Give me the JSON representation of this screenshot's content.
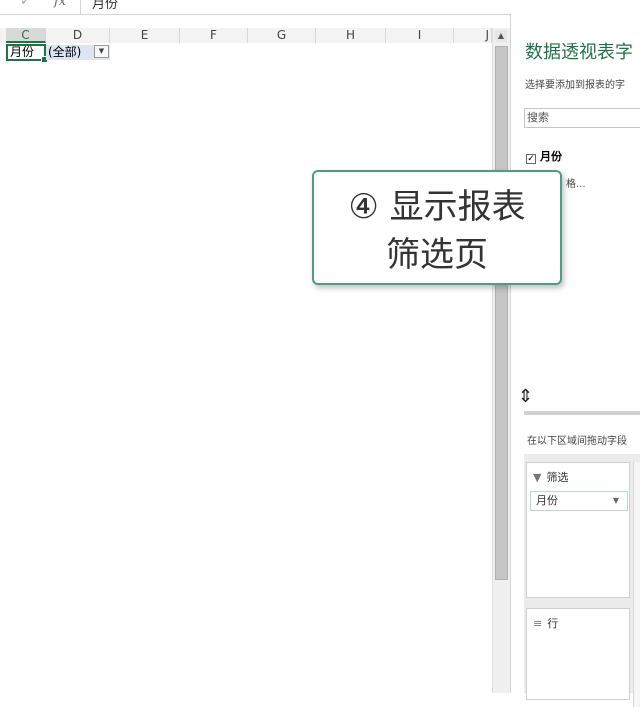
{
  "formula_bar": {
    "check_icon": "check-icon",
    "fx_label": "fx",
    "value": "月份"
  },
  "columns": [
    "C",
    "D",
    "E",
    "F",
    "G",
    "H",
    "I",
    "J"
  ],
  "cells": {
    "active_cell": "月份",
    "filter_value": "(全部)"
  },
  "pivot_pane": {
    "title": "数据透视表字",
    "subtitle": "选择要添加到报表的字",
    "search_placeholder": "搜索",
    "fields": [
      {
        "label": "月份",
        "checked": true
      }
    ],
    "more_tables": "格...",
    "areas_instruction": "在以下区域间拖动字段",
    "filter_area": {
      "label": "筛选",
      "field": "月份"
    },
    "rows_area": {
      "label": "行"
    }
  },
  "callout": {
    "line1": "④ 显示报表",
    "line2": "筛选页"
  },
  "colors": {
    "accent": "#217346",
    "callout_border": "#4d9e88",
    "filter_cell_bg": "#dde4f2"
  }
}
